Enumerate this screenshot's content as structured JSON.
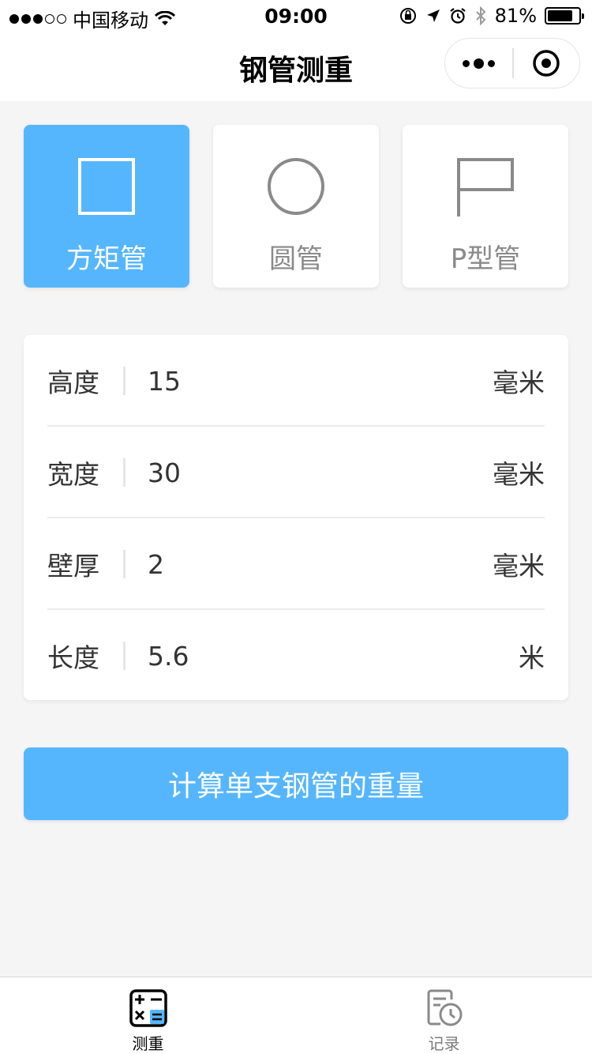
{
  "status_bar": {
    "carrier": "中国移动",
    "time": "09:00",
    "battery_text": "81%",
    "battery_level": 0.81
  },
  "nav": {
    "title": "钢管测重"
  },
  "shapes": [
    {
      "label": "方矩管",
      "icon": "square-icon",
      "active": true
    },
    {
      "label": "圆管",
      "icon": "circle-icon",
      "active": false
    },
    {
      "label": "P型管",
      "icon": "flag-icon",
      "active": false
    }
  ],
  "form": {
    "rows": [
      {
        "label": "高度",
        "value": "15",
        "unit": "毫米"
      },
      {
        "label": "宽度",
        "value": "30",
        "unit": "毫米"
      },
      {
        "label": "壁厚",
        "value": "2",
        "unit": "毫米"
      },
      {
        "label": "长度",
        "value": "5.6",
        "unit": "米"
      }
    ]
  },
  "calc_button": {
    "label": "计算单支钢管的重量"
  },
  "tab_bar": {
    "tabs": [
      {
        "label": "测重",
        "icon": "calculator-icon",
        "active": true
      },
      {
        "label": "记录",
        "icon": "history-icon",
        "active": false
      }
    ]
  },
  "colors": {
    "accent": "#56b6fd",
    "background": "#f5f5f5",
    "inactive_text": "#8a8a8a"
  }
}
